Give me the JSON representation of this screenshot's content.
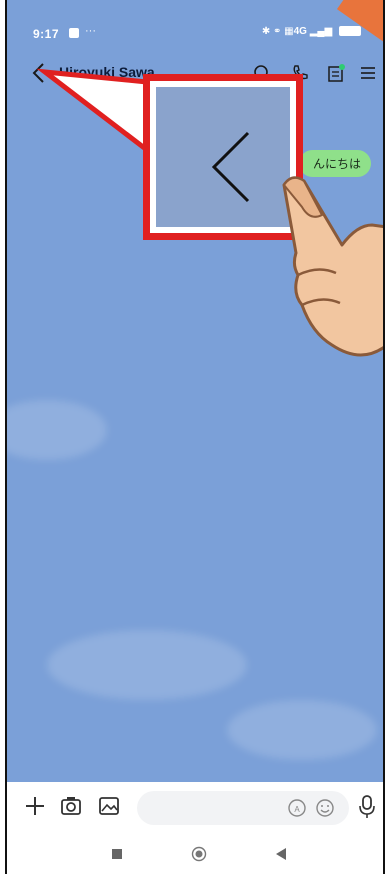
{
  "status_bar": {
    "time": "9:17",
    "dots": "···",
    "right_indicators": "✱ ⚭ ▦4G ▂▄▆"
  },
  "header": {
    "contact_name": "Hiroyuki Sawa"
  },
  "messages": [
    {
      "text": "んにちは",
      "side": "right",
      "color": "#8fe08a"
    }
  ],
  "input_bar": {
    "placeholder": ""
  },
  "icons": {
    "back": "chevron-left-icon",
    "search": "search-icon",
    "call": "phone-icon",
    "notes": "notes-icon",
    "menu": "menu-icon",
    "add": "plus-icon",
    "camera": "camera-icon",
    "gallery": "image-icon",
    "ai": "ai-icon",
    "emoji": "emoji-icon",
    "mic": "microphone-icon"
  },
  "colors": {
    "chat_background": "#7ba0d8",
    "bubble": "#8fe08a",
    "callout": "#e02020",
    "hand": "#f2c6a0"
  }
}
